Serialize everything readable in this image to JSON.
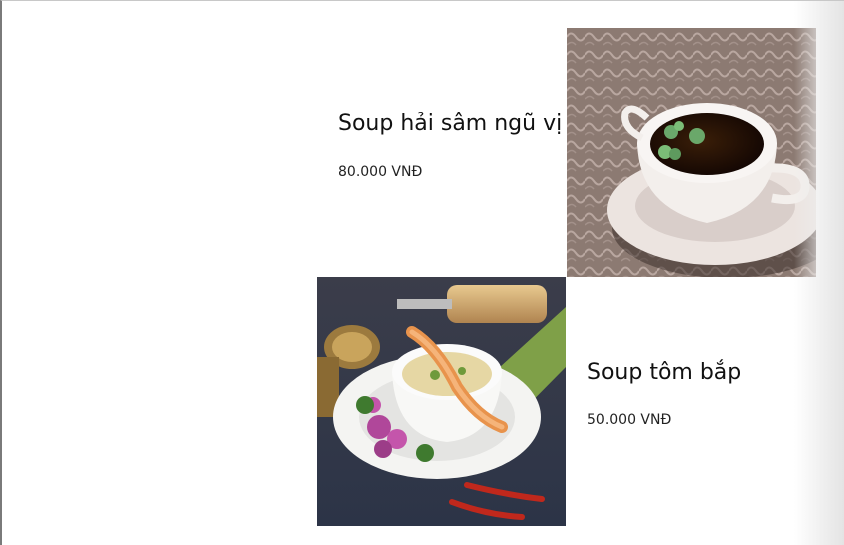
{
  "menu": {
    "items": [
      {
        "name": "Soup hải sâm ngũ vị",
        "price": "80.000 VNĐ",
        "image_icon": "sea-cucumber-soup-photo"
      },
      {
        "name": "Soup tôm bắp",
        "price": "50.000 VNĐ",
        "image_icon": "shrimp-corn-soup-photo"
      }
    ]
  }
}
